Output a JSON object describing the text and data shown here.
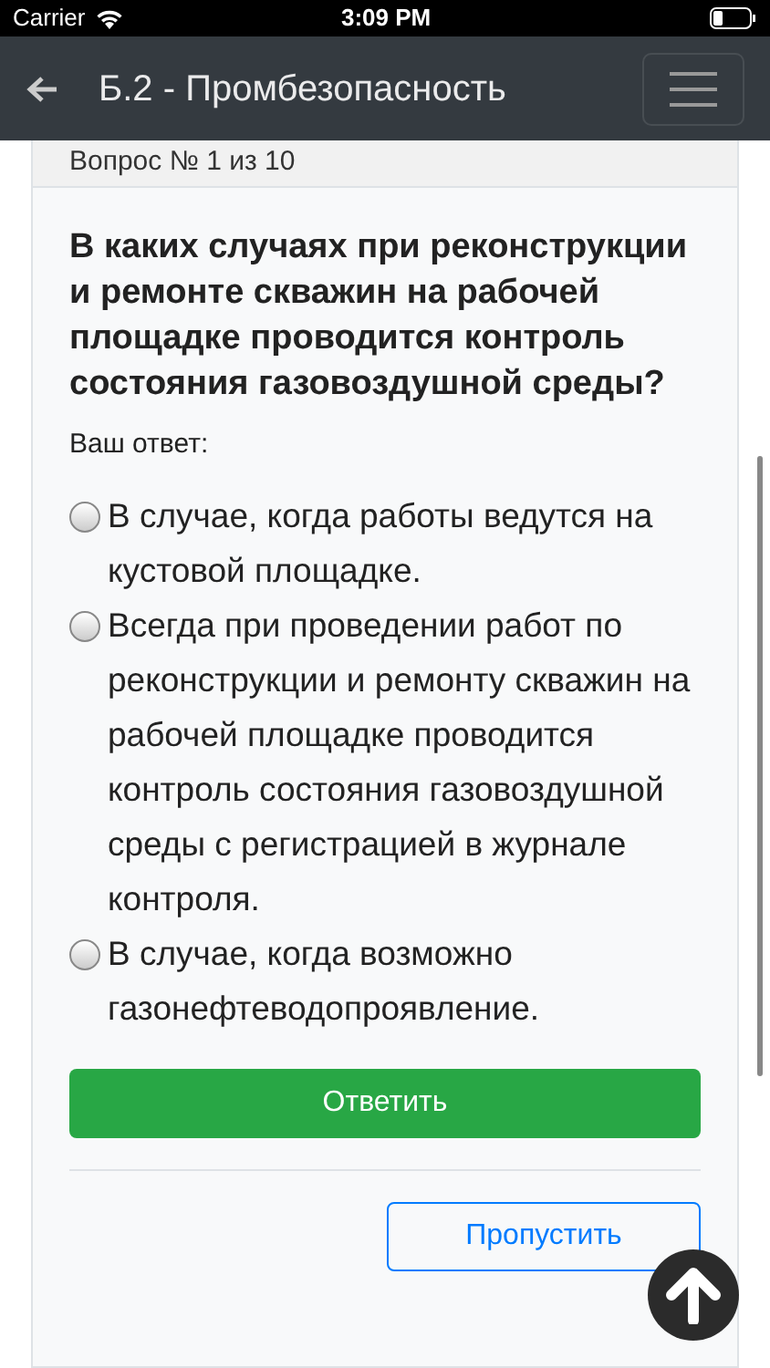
{
  "status_bar": {
    "carrier": "Carrier",
    "time": "3:09 PM"
  },
  "nav": {
    "title": "Б.2 - Промбезопасность"
  },
  "card": {
    "header": "Вопрос № 1 из 10",
    "question": "В каких случаях при реконструкции и ремонте скважин на рабочей площадке проводится контроль состояния газовоздушной среды?",
    "answer_label": "Ваш ответ:",
    "options": [
      {
        "label": "В случае, когда работы ведутся на кустовой площадке.",
        "selected": false
      },
      {
        "label": "Всегда при проведении работ по реконструкции и ремонту скважин на рабочей площадке проводится контроль состояния газовоздушной среды с регистрацией в журнале контроля.",
        "selected": false
      },
      {
        "label": "В случае, когда возможно газонефтеводопроявление.",
        "selected": false
      }
    ],
    "submit": "Ответить",
    "skip": "Пропустить"
  }
}
